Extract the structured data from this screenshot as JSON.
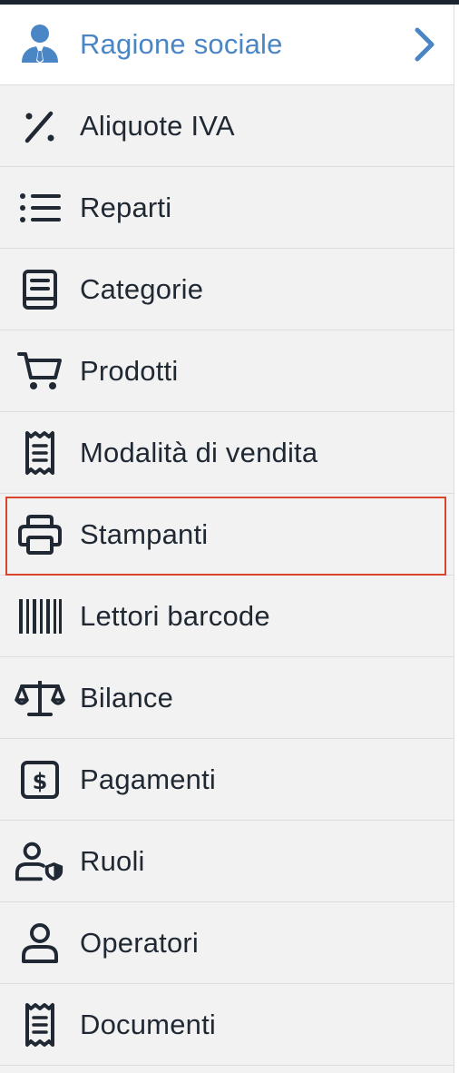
{
  "header": {
    "label": "Ragione sociale",
    "icon": "business-person-icon",
    "chevron": "chevron-right-icon",
    "accent": "#4a86c5"
  },
  "menu": {
    "items": [
      {
        "label": "Aliquote IVA",
        "icon": "percent-icon"
      },
      {
        "label": "Reparti",
        "icon": "list-icon"
      },
      {
        "label": "Categorie",
        "icon": "book-icon"
      },
      {
        "label": "Prodotti",
        "icon": "cart-icon"
      },
      {
        "label": "Modalità di vendita",
        "icon": "receipt-icon"
      },
      {
        "label": "Stampanti",
        "icon": "printer-icon",
        "selected": true
      },
      {
        "label": "Lettori barcode",
        "icon": "barcode-icon"
      },
      {
        "label": "Bilance",
        "icon": "scale-icon"
      },
      {
        "label": "Pagamenti",
        "icon": "dollar-icon"
      },
      {
        "label": "Ruoli",
        "icon": "user-shield-icon"
      },
      {
        "label": "Operatori",
        "icon": "user-icon"
      },
      {
        "label": "Documenti",
        "icon": "receipt-icon"
      }
    ]
  },
  "colors": {
    "text": "#1f2833",
    "selection_border": "#d9452c",
    "background": "#f2f2f2"
  }
}
